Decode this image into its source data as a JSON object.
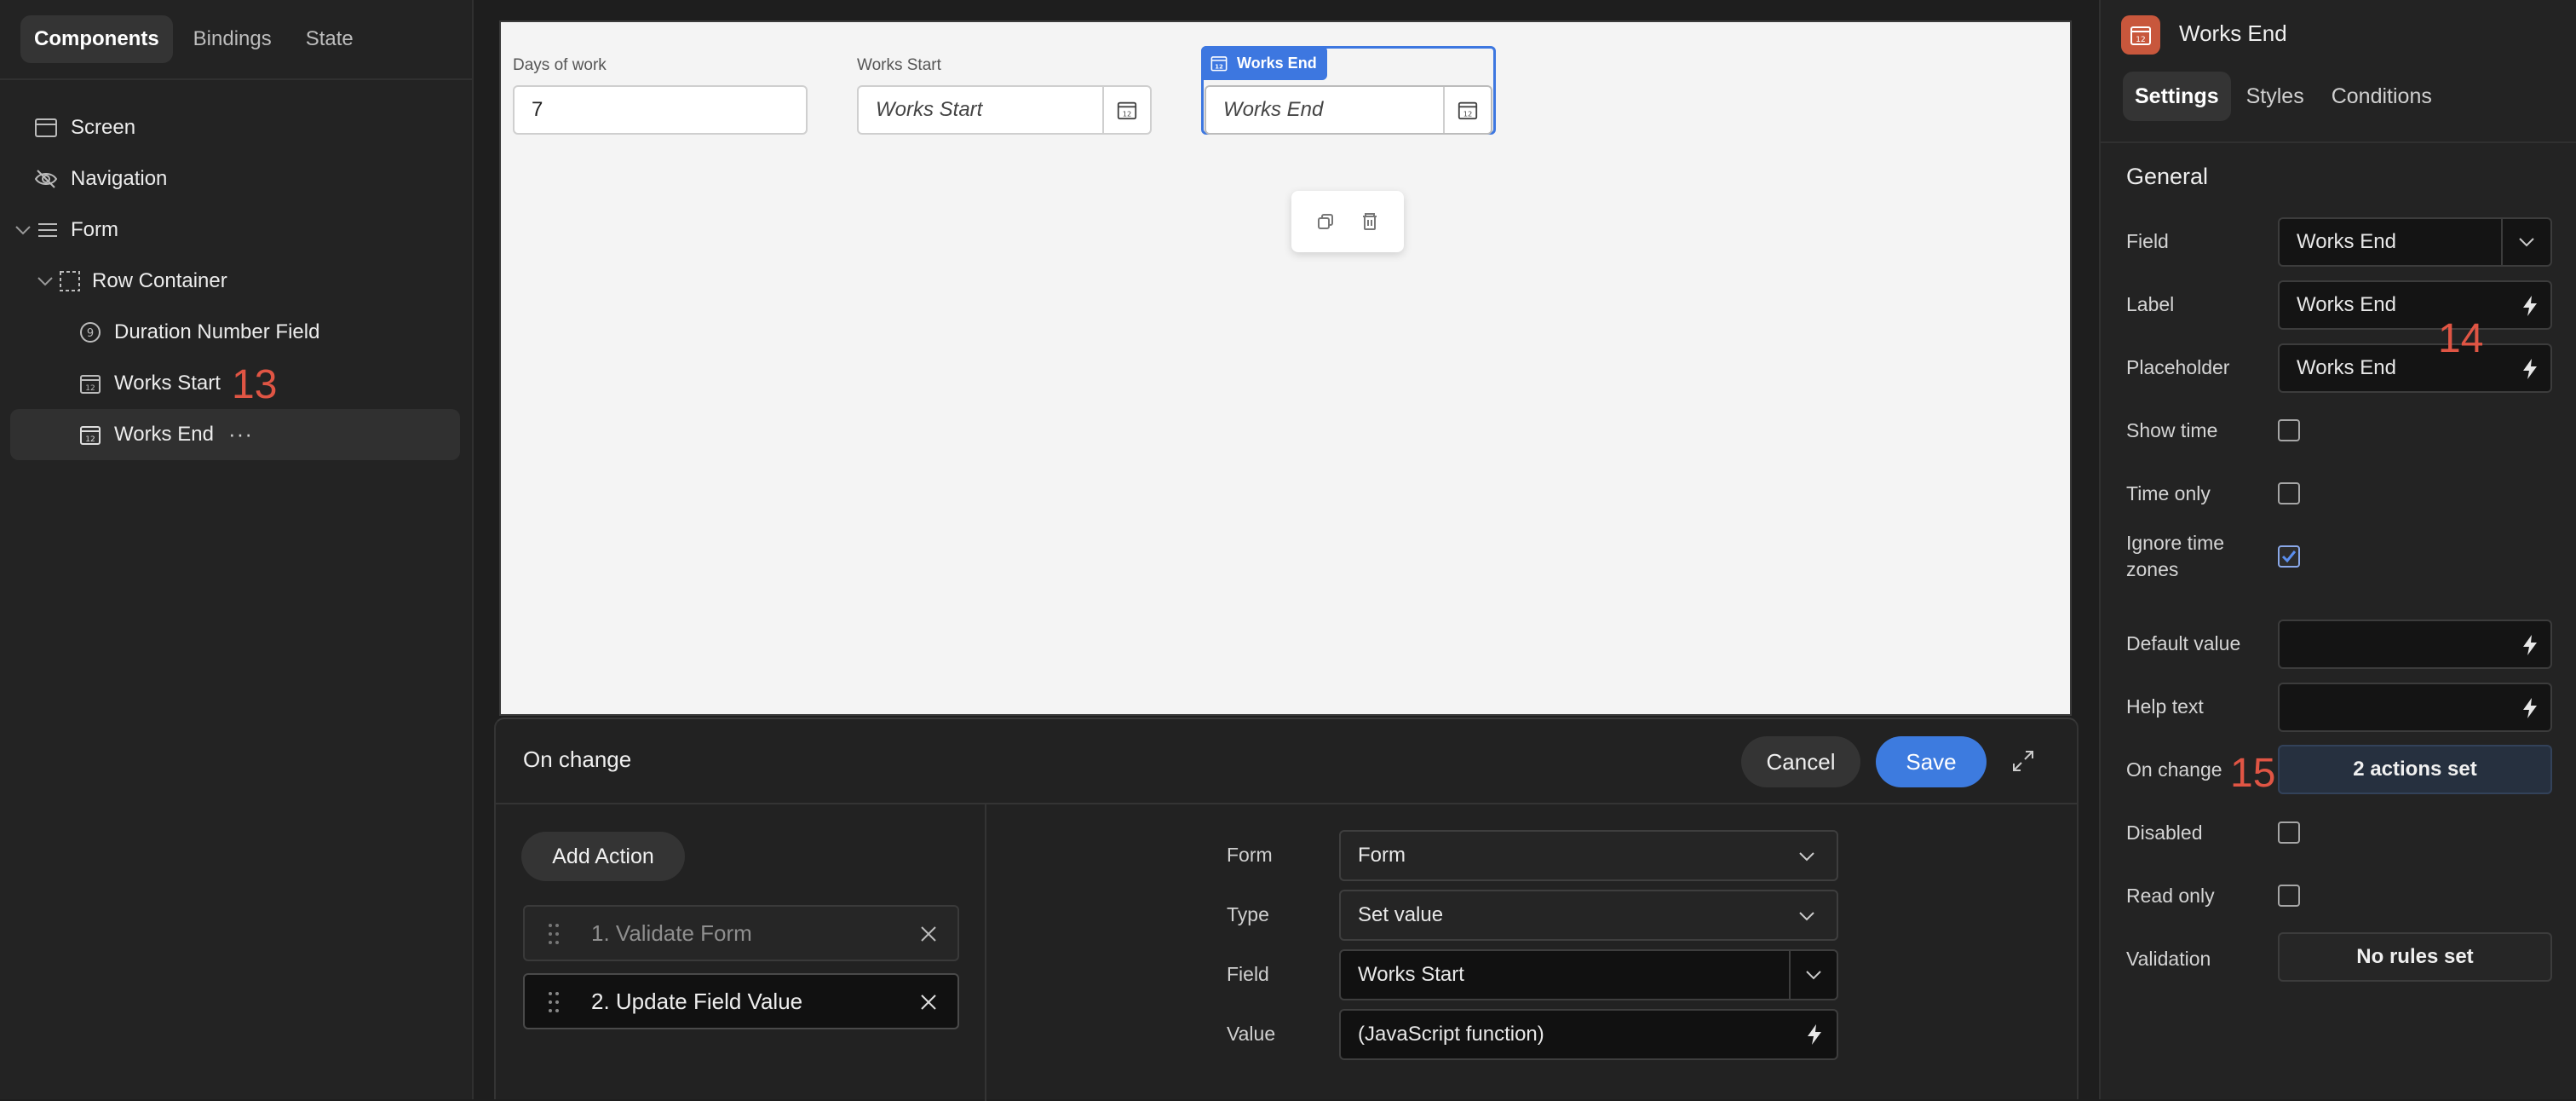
{
  "left_panel": {
    "tabs": [
      "Components",
      "Bindings",
      "State"
    ],
    "tree": {
      "screen": "Screen",
      "navigation": "Navigation",
      "form": "Form",
      "row_container": "Row Container",
      "duration_field": "Duration Number Field",
      "works_start": "Works Start",
      "works_end": "Works End"
    },
    "more_dots": "···"
  },
  "annotations": {
    "a13": "13",
    "a14": "14",
    "a15": "15"
  },
  "canvas": {
    "field1": {
      "label": "Days of work",
      "value": "7"
    },
    "field2": {
      "label": "Works Start",
      "placeholder": "Works Start"
    },
    "field3": {
      "tag": "Works End",
      "placeholder": "Works End"
    }
  },
  "onchange": {
    "title": "On change",
    "cancel": "Cancel",
    "save": "Save",
    "add_action": "Add Action",
    "actions": [
      "1. Validate Form",
      "2. Update Field Value"
    ],
    "fields": [
      {
        "label": "Form",
        "value": "Form"
      },
      {
        "label": "Type",
        "value": "Set value"
      },
      {
        "label": "Field",
        "value": "Works Start"
      },
      {
        "label": "Value",
        "value": "(JavaScript function)"
      }
    ]
  },
  "right_panel": {
    "title": "Works End",
    "tabs": [
      "Settings",
      "Styles",
      "Conditions"
    ],
    "section": "General",
    "field": {
      "label": "Field",
      "value": "Works End"
    },
    "label": {
      "label": "Label",
      "value": "Works End"
    },
    "placeholder": {
      "label": "Placeholder",
      "value": "Works End"
    },
    "show_time": "Show time",
    "time_only": "Time only",
    "ignore_tz": "Ignore time zones",
    "default_value": "Default value",
    "help_text": "Help text",
    "on_change": {
      "label": "On change",
      "value": "2 actions set"
    },
    "disabled": "Disabled",
    "read_only": "Read only",
    "validation": {
      "label": "Validation",
      "value": "No rules set"
    }
  },
  "colors": {
    "accent": "#3d7bdf",
    "annotation": "#e05544",
    "component_icon": "#c8573c"
  }
}
